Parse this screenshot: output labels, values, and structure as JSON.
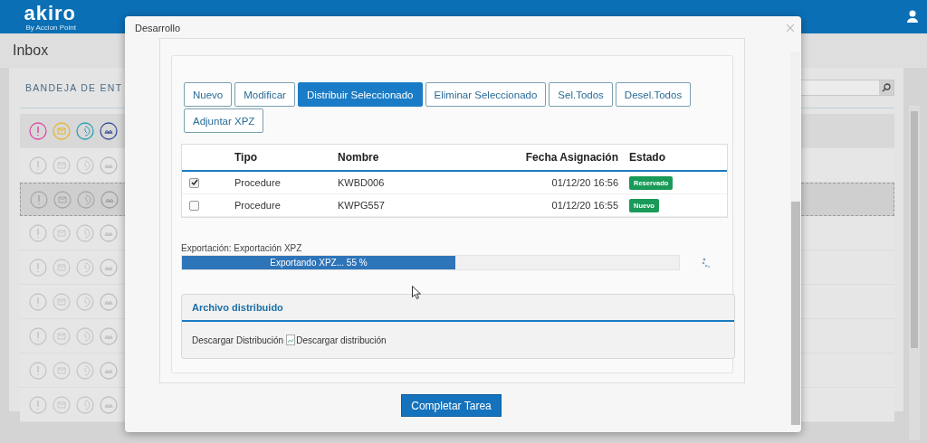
{
  "header": {
    "logo": "akiro",
    "tagline": "By Accion Point"
  },
  "page": {
    "title": "Inbox",
    "panel_title": "BANDEJA DE ENT"
  },
  "inbox_rows": [
    {
      "selected": false
    },
    {
      "selected": true
    },
    {
      "selected": false
    },
    {
      "selected": false
    },
    {
      "selected": false
    },
    {
      "selected": false
    },
    {
      "selected": false
    },
    {
      "selected": false
    }
  ],
  "dialog": {
    "title": "Desarrollo",
    "toolbar_rows": [
      [
        {
          "label": "Nuevo",
          "primary": false
        },
        {
          "label": "Modificar",
          "primary": false
        },
        {
          "label": "Distribuir Seleccionado",
          "primary": true
        },
        {
          "label": "Eliminar Seleccionado",
          "primary": false
        },
        {
          "label": "Sel.Todos",
          "primary": false
        },
        {
          "label": "Desel.Todos",
          "primary": false
        }
      ],
      [
        {
          "label": "Adjuntar XPZ",
          "primary": false
        }
      ]
    ],
    "table": {
      "columns": [
        "Tipo",
        "Nombre",
        "Fecha Asignación",
        "Estado"
      ],
      "rows": [
        {
          "checked": true,
          "tipo": "Procedure",
          "nombre": "KWBD006",
          "fecha": "01/12/20 16:56",
          "estado": "Reservado"
        },
        {
          "checked": false,
          "tipo": "Procedure",
          "nombre": "KWPG557",
          "fecha": "01/12/20 16:55",
          "estado": "Nuevo"
        }
      ]
    },
    "export": {
      "label": "Exportación: Exportación XPZ",
      "progress_text": "Exportando XPZ... 55 %",
      "level": 0.55
    },
    "distributed": {
      "title": "Archivo distribuido",
      "text": "Descargar Distribución",
      "image_alt": "Descargar distribución"
    },
    "complete_button": "Completar Tarea"
  }
}
